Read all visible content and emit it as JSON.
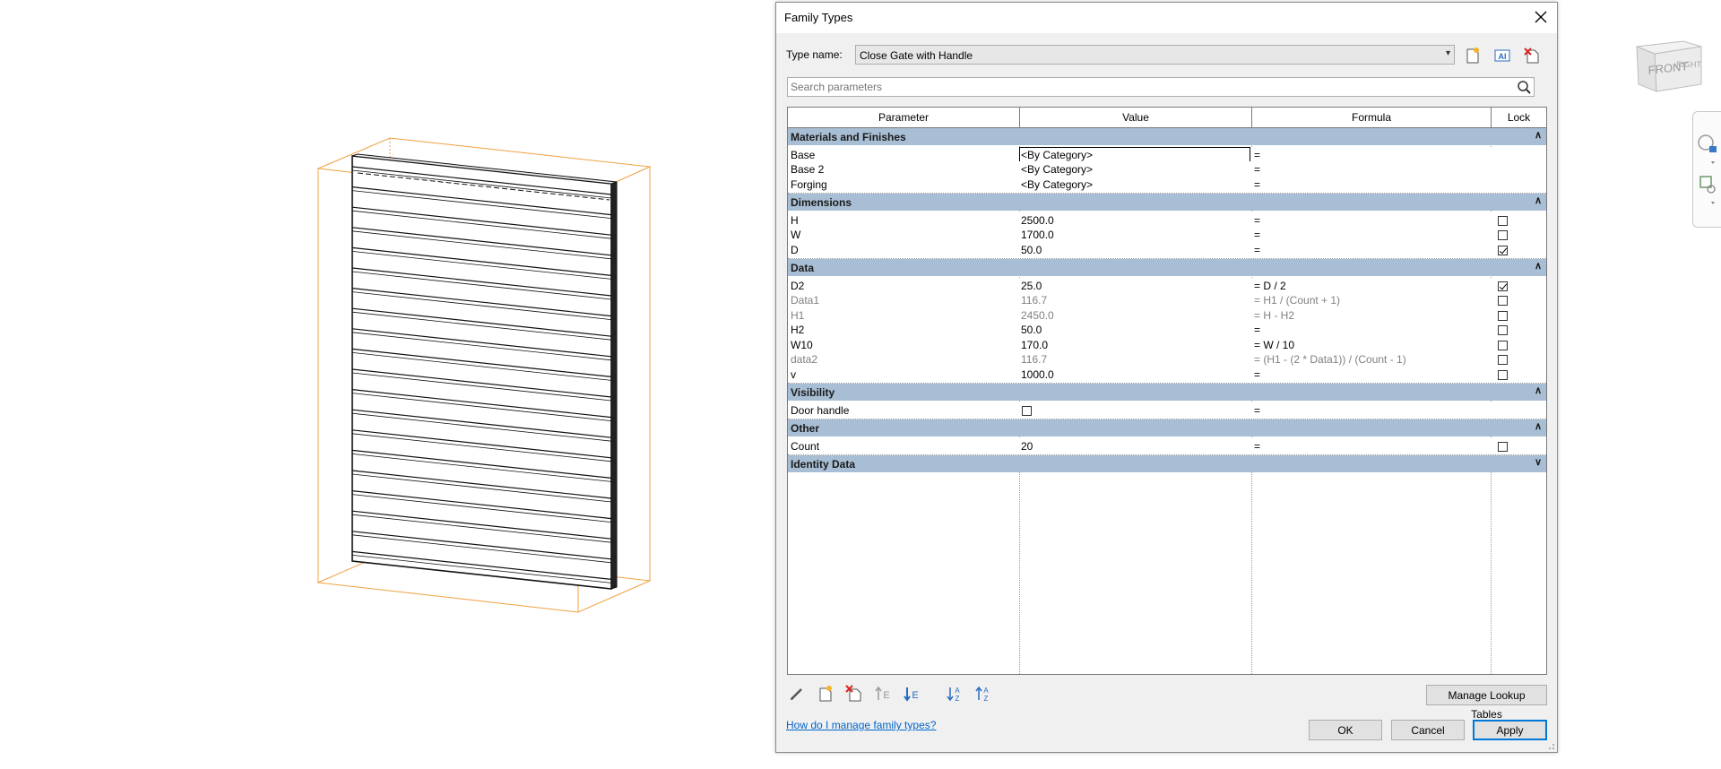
{
  "dialog": {
    "title": "Family Types",
    "type_name_label": "Type name:",
    "type_name_value": "Close Gate with Handle",
    "search_placeholder": "Search parameters",
    "help_link": "How do I manage family types?",
    "manage_lookup_label": "Manage Lookup Tables",
    "ok_label": "OK",
    "cancel_label": "Cancel",
    "apply_label": "Apply"
  },
  "grid": {
    "columns": [
      "Parameter",
      "Value",
      "Formula",
      "Lock"
    ],
    "groups": [
      {
        "label": "Materials and Finishes",
        "toggle": "⌃",
        "rows": [
          {
            "param": "Base",
            "value": "<By Category>",
            "formula": "=",
            "lock": null
          },
          {
            "param": "Base 2",
            "value": "<By Category>",
            "formula": "=",
            "lock": null
          },
          {
            "param": "Forging",
            "value": "<By Category>",
            "formula": "=",
            "lock": null
          }
        ]
      },
      {
        "label": "Dimensions",
        "toggle": "⌃",
        "rows": [
          {
            "param": "H",
            "value": "2500.0",
            "formula": "=",
            "lock": false
          },
          {
            "param": "W",
            "value": "1700.0",
            "formula": "=",
            "lock": false
          },
          {
            "param": "D",
            "value": "50.0",
            "formula": "=",
            "lock": true
          }
        ]
      },
      {
        "label": "Data",
        "toggle": "⌃",
        "rows": [
          {
            "param": "D2",
            "value": "25.0",
            "formula": "= D / 2",
            "lock": true
          },
          {
            "param": "Data1",
            "value": "116.7",
            "formula": "= H1 / (Count + 1)",
            "lock": false,
            "gray": true
          },
          {
            "param": "H1",
            "value": "2450.0",
            "formula": "= H - H2",
            "lock": false,
            "gray": true
          },
          {
            "param": "H2",
            "value": "50.0",
            "formula": "=",
            "lock": false
          },
          {
            "param": "W10",
            "value": "170.0",
            "formula": "= W / 10",
            "lock": false
          },
          {
            "param": "data2",
            "value": "116.7",
            "formula": "= (H1 - (2 * Data1)) / (Count - 1)",
            "lock": false,
            "gray": true
          },
          {
            "param": "v",
            "value": "1000.0",
            "formula": "=",
            "lock": false
          }
        ]
      },
      {
        "label": "Visibility",
        "toggle": "⌃",
        "rows": [
          {
            "param": "Door handle",
            "value_checkbox": false,
            "formula": "=",
            "lock": null
          }
        ]
      },
      {
        "label": "Other",
        "toggle": "⌃",
        "rows": [
          {
            "param": "Count",
            "value": "20",
            "formula": "=",
            "lock": false
          }
        ]
      },
      {
        "label": "Identity Data",
        "toggle": "⌄",
        "rows": []
      }
    ]
  },
  "viewcube": {
    "face_label": "FRONT",
    "side_label": "RIGHT"
  },
  "colors": {
    "group_header": "#a8bed4",
    "bounding_box": "#f0a040",
    "link": "#0066cc",
    "default_button_border": "#0078d7"
  },
  "icons": [
    "close-icon",
    "new-type-icon",
    "rename-type-icon",
    "delete-type-icon",
    "search-icon",
    "edit-parameter-icon",
    "new-parameter-icon",
    "delete-parameter-icon",
    "move-up-icon",
    "move-down-icon",
    "sort-ascending-icon",
    "sort-descending-icon"
  ]
}
